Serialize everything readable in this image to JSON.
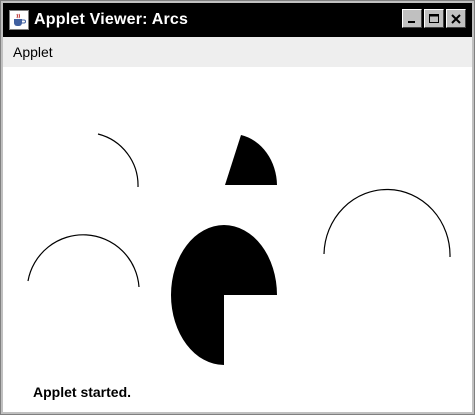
{
  "window": {
    "title": "Applet Viewer: Arcs",
    "icon": "java-cup-icon",
    "buttons": [
      "minimize-icon",
      "maximize-icon",
      "close-icon"
    ],
    "title_bar_color": "#000000",
    "title_text_color": "#ffffff"
  },
  "menubar": {
    "items": [
      {
        "label": "Applet"
      }
    ]
  },
  "applet": {
    "background": "#ffffff",
    "shapes": [
      {
        "kind": "arc-outline",
        "description": "small upper-right quarter arc"
      },
      {
        "kind": "filled-arc",
        "description": "filled quarter pie wedge"
      },
      {
        "kind": "arc-outline",
        "description": "upper half arc"
      },
      {
        "kind": "filled-arc",
        "description": "three-quarter filled pie"
      },
      {
        "kind": "arc-outline",
        "description": "upper half arc"
      }
    ],
    "fill_color": "#000000",
    "stroke_color": "#000000"
  },
  "status": {
    "text": "Applet started."
  }
}
